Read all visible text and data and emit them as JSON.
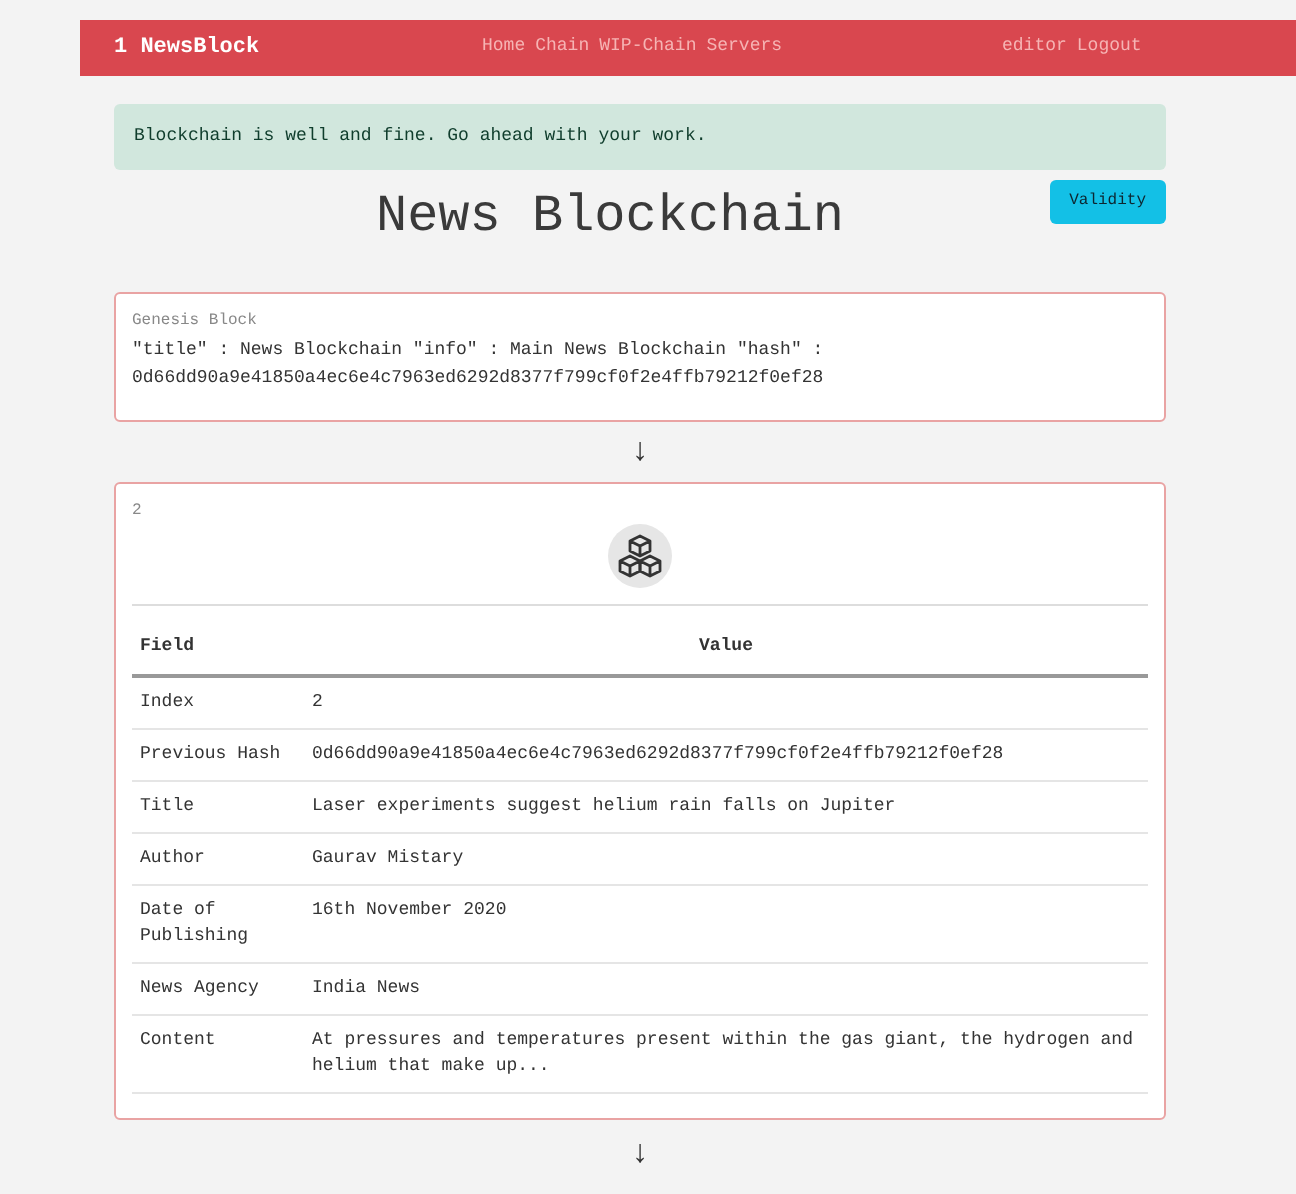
{
  "navbar": {
    "brand": "1 NewsBlock",
    "links": [
      "Home",
      "Chain",
      "WIP-Chain",
      "Servers"
    ],
    "user_links": [
      "editor",
      "Logout"
    ]
  },
  "alert": "Blockchain is well and fine. Go ahead with your work.",
  "heading": "News Blockchain",
  "validity_button": "Validity",
  "genesis": {
    "label": "Genesis Block",
    "text": "\"title\" : News Blockchain \"info\" : Main News Blockchain \"hash\" : 0d66dd90a9e41850a4ec6e4c7963ed6292d8377f799cf0f2e4ffb79212f0ef28"
  },
  "arrows": [
    "↓",
    "↓"
  ],
  "block": {
    "number": "2",
    "columns": [
      "Field",
      "Value"
    ],
    "rows": [
      {
        "field": "Index",
        "value": "2"
      },
      {
        "field": "Previous Hash",
        "value": "0d66dd90a9e41850a4ec6e4c7963ed6292d8377f799cf0f2e4ffb79212f0ef28"
      },
      {
        "field": "Title",
        "value": "Laser experiments suggest helium rain falls on Jupiter"
      },
      {
        "field": "Author",
        "value": "Gaurav Mistary"
      },
      {
        "field": "Date of Publishing",
        "value": "16th November 2020"
      },
      {
        "field": "News Agency",
        "value": "India News"
      },
      {
        "field": "Content",
        "value": "At pressures and temperatures present within the gas giant, the hydrogen and helium that make up..."
      }
    ]
  }
}
